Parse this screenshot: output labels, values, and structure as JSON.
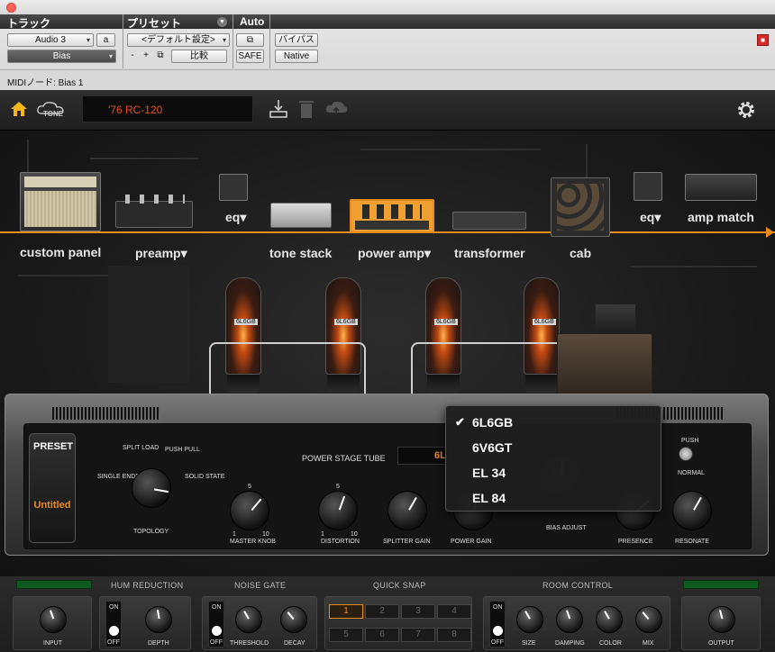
{
  "host": {
    "track_header": "トラック",
    "preset_header": "プリセット",
    "auto_header": "Auto",
    "track_name": "Audio 3",
    "track_letter": "a",
    "insert_name": "Bias",
    "preset_select": "<デフォルト設定>",
    "minus": "-",
    "plus": "+",
    "compare": "比較",
    "safe": "SAFE",
    "bypass": "バイパス",
    "native": "Native",
    "midi_node": "MIDIノード: Bias 1"
  },
  "toolbar": {
    "preset_name": "'76 RC-120",
    "tone_label": "TONE"
  },
  "chain": {
    "custom_panel": "custom panel",
    "preamp": "preamp▾",
    "eq1": "eq▾",
    "tone_stack": "tone stack",
    "power_amp": "power amp▾",
    "transformer": "transformer",
    "cab": "cab",
    "eq2": "eq▾",
    "amp_match": "amp match",
    "selected": "power amp"
  },
  "amp": {
    "preset_label": "PRESET",
    "preset_value": "Untitled",
    "topology_label": "TOPOLOGY",
    "topology_options": [
      "SPLIT LOAD",
      "PUSH PULL",
      "SINGLE ENDED",
      "SOLID STATE"
    ],
    "knob_scale": {
      "min": "1",
      "max": "10",
      "mid": "5"
    },
    "knobs": [
      "MASTER KNOB",
      "DISTORTION",
      "SPLITTER GAIN",
      "POWER GAIN",
      "BIAS ADJUST",
      "PRESENCE",
      "RESONATE"
    ],
    "power_stage_label": "POWER STAGE TUBE",
    "power_stage_value": "6L",
    "push_label": "PUSH",
    "normal_label": "NORMAL",
    "tube_label": "6L6GB"
  },
  "dropdown": {
    "items": [
      "6L6GB",
      "6V6GT",
      "EL 34",
      "EL 84"
    ],
    "checked": "6L6GB"
  },
  "rack": {
    "hum_reduction": "HUM REDUCTION",
    "noise_gate": "NOISE GATE",
    "quick_snap": "QUICK SNAP",
    "room_control": "ROOM CONTROL",
    "input": "INPUT",
    "depth": "DEPTH",
    "threshold": "THRESHOLD",
    "decay": "DECAY",
    "size": "SIZE",
    "damping": "DAMPING",
    "color": "COLOR",
    "mix": "MIX",
    "output": "OUTPUT",
    "on": "ON",
    "off": "OFF",
    "snaps": [
      "1",
      "2",
      "3",
      "4",
      "5",
      "6",
      "7",
      "8"
    ],
    "active_snap": "1"
  },
  "colors": {
    "accent": "#e88c20",
    "led": "#0e5a1e"
  }
}
